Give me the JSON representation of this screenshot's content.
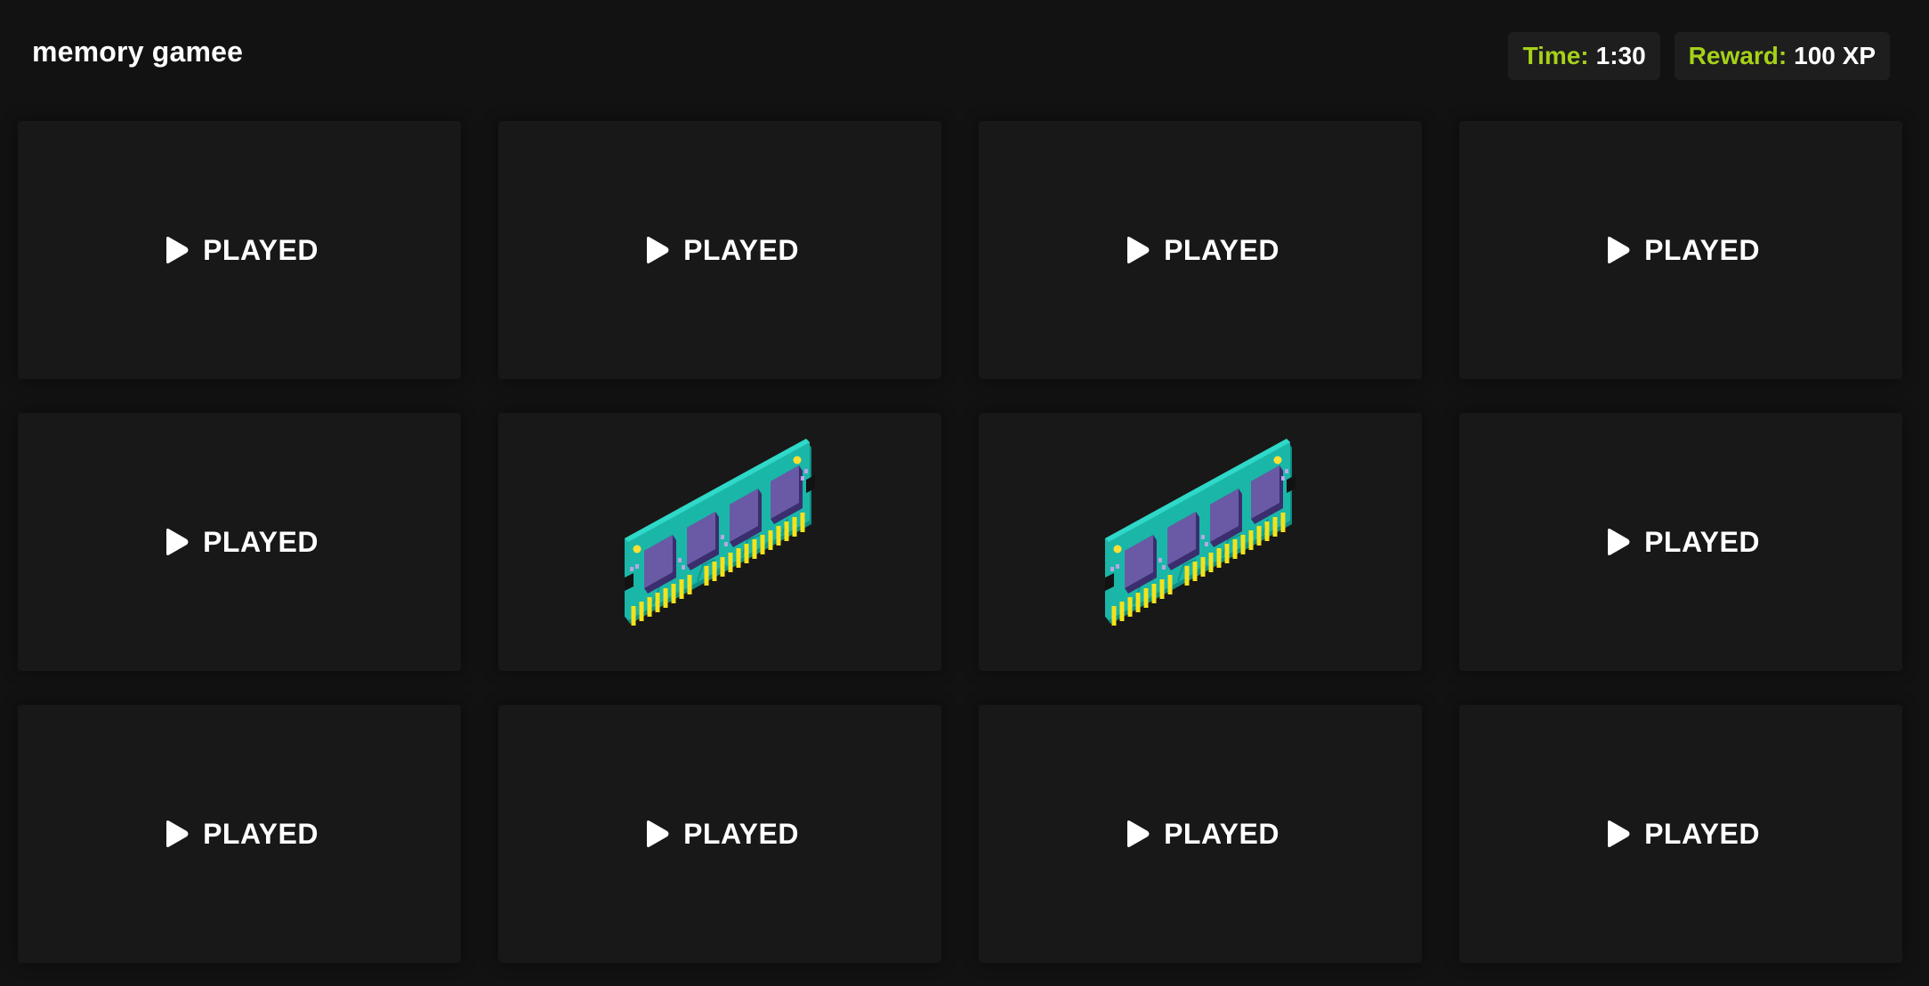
{
  "game": {
    "title": "memory gamee"
  },
  "stats": {
    "time_label": "Time:",
    "time_value": "1:30",
    "reward_label": "Reward:",
    "reward_value": "100 XP",
    "label_color": "#a6d119"
  },
  "cards": [
    {
      "state": "played",
      "label": "PLAYED"
    },
    {
      "state": "played",
      "label": "PLAYED"
    },
    {
      "state": "played",
      "label": "PLAYED"
    },
    {
      "state": "played",
      "label": "PLAYED"
    },
    {
      "state": "played",
      "label": "PLAYED"
    },
    {
      "state": "revealed",
      "icon": "ram-memory-icon"
    },
    {
      "state": "revealed",
      "icon": "ram-memory-icon"
    },
    {
      "state": "played",
      "label": "PLAYED"
    },
    {
      "state": "played",
      "label": "PLAYED"
    },
    {
      "state": "played",
      "label": "PLAYED"
    },
    {
      "state": "played",
      "label": "PLAYED"
    },
    {
      "state": "played",
      "label": "PLAYED"
    }
  ]
}
